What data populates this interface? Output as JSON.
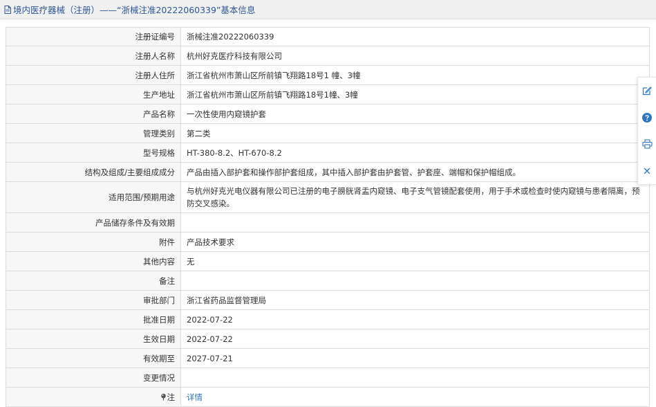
{
  "header": {
    "title": "境内医疗器械（注册）——“浙械注准20222060339”基本信息"
  },
  "rows": [
    {
      "label": "注册证编号",
      "value": "浙械注准20222060339"
    },
    {
      "label": "注册人名称",
      "value": "杭州好克医疗科技有限公司"
    },
    {
      "label": "注册人住所",
      "value": "浙江省杭州市萧山区所前镇飞翔路18号1 幢、3幢"
    },
    {
      "label": "生产地址",
      "value": "浙江省杭州市萧山区所前镇飞翔路18号1幢、3幢"
    },
    {
      "label": "产品名称",
      "value": "一次性使用内窥镜护套"
    },
    {
      "label": "管理类别",
      "value": "第二类"
    },
    {
      "label": "型号规格",
      "value": "HT-380-8.2、HT-670-8.2"
    },
    {
      "label": "结构及组成/主要组成成分",
      "value": "产品由插入部护套和操作部护套组成，其中插入部护套由护套管、护套座、端帽和保护帽组成。"
    },
    {
      "label": "适用范围/预期用途",
      "value": "与杭州好克光电仪器有限公司已注册的电子膀胱肾盂内窥镜、电子支气管镜配套使用，用于手术或检查时使内窥镜与患者隔离，预防交叉感染。"
    },
    {
      "label": "产品储存条件及有效期",
      "value": ""
    },
    {
      "label": "附件",
      "value": "产品技术要求"
    },
    {
      "label": "其他内容",
      "value": "无"
    },
    {
      "label": "备注",
      "value": ""
    },
    {
      "label": "审批部门",
      "value": "浙江省药品监督管理局"
    },
    {
      "label": "批准日期",
      "value": "2022-07-22"
    },
    {
      "label": "生效日期",
      "value": "2022-07-22"
    },
    {
      "label": "有效期至",
      "value": "2027-07-21"
    },
    {
      "label": "变更情况",
      "value": ""
    }
  ],
  "note_row": {
    "label": "注",
    "link": "详情",
    "icon": "pin-icon"
  },
  "side_toolbar": {
    "icons": [
      "edit-icon",
      "help-icon",
      "print-icon",
      "close-icon"
    ],
    "accent_color": "#2f74c0"
  },
  "colors": {
    "header_text": "#2f5597",
    "label_bg": "#f7f7f7",
    "border": "#dcdcdc",
    "link": "#2f74c0"
  }
}
